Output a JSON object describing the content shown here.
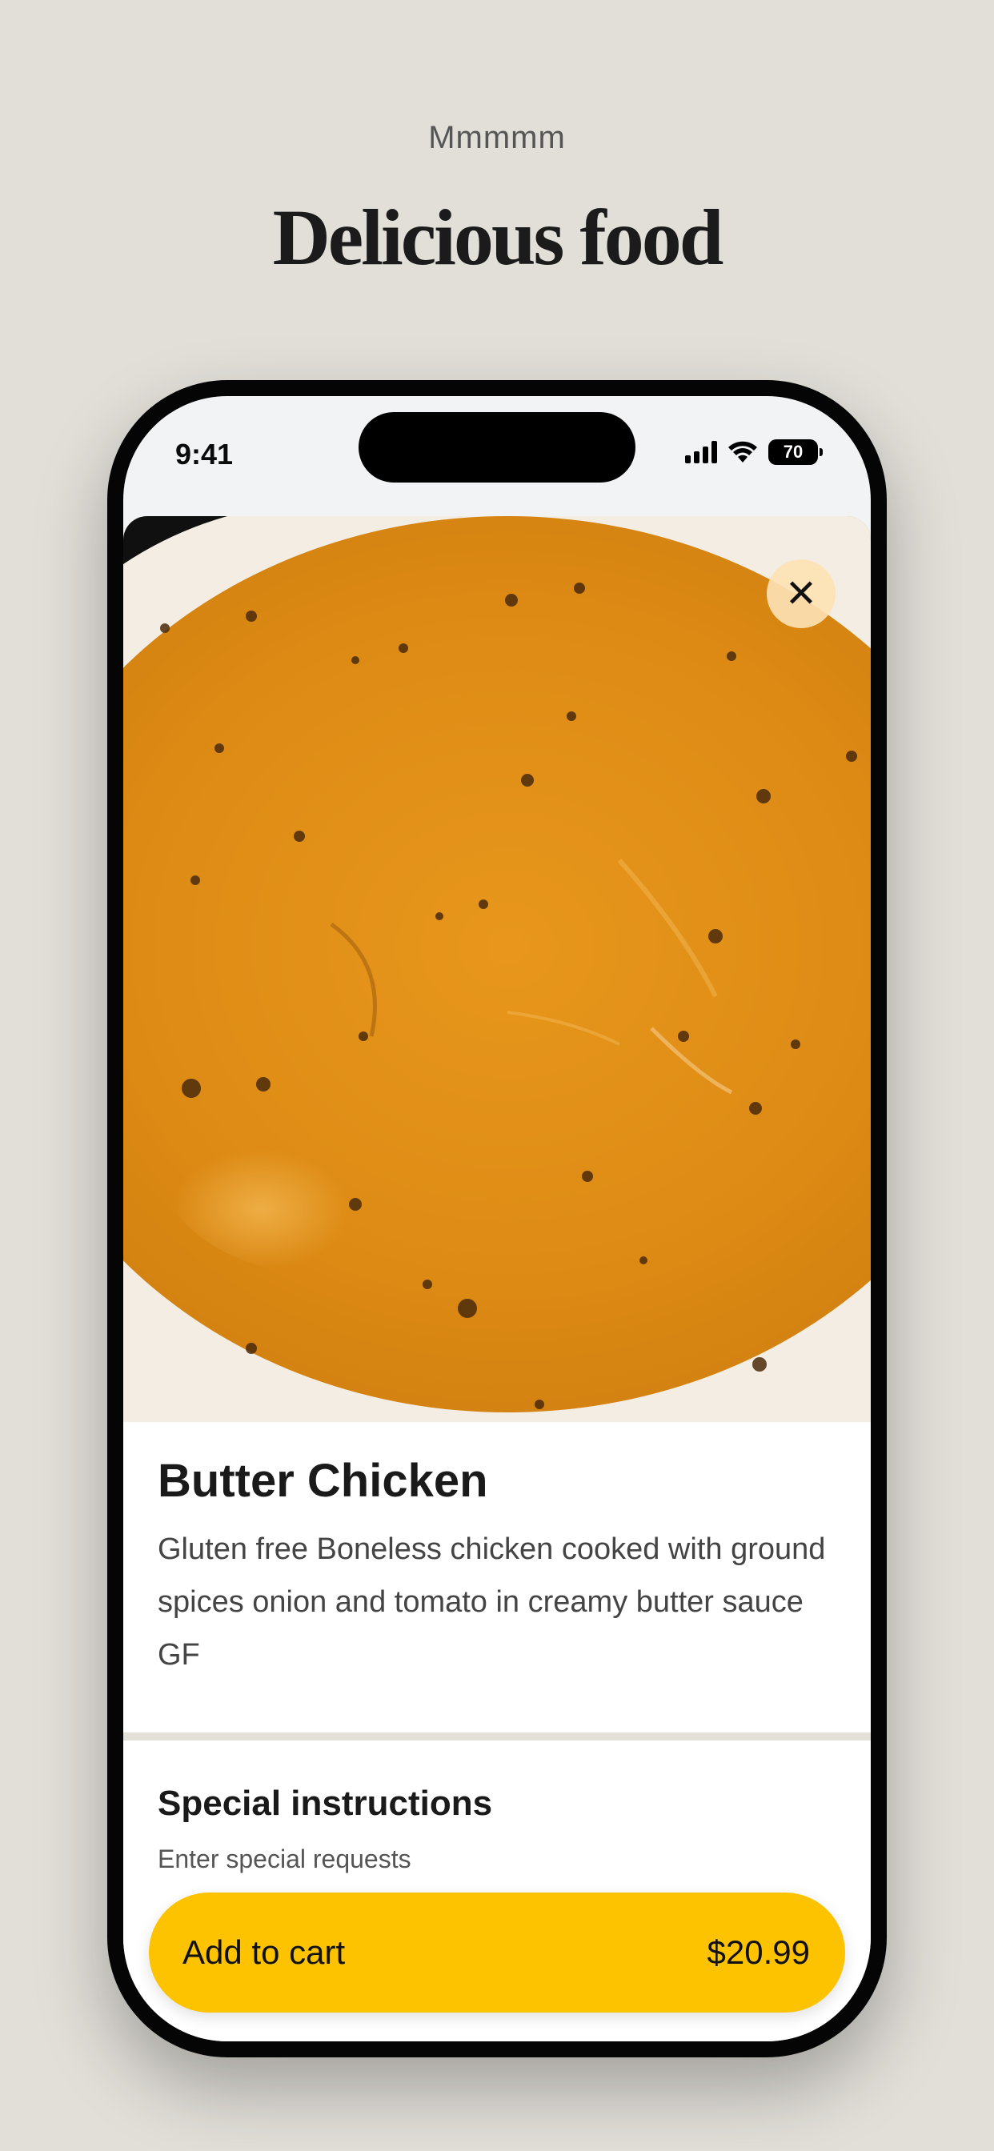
{
  "header": {
    "eyebrow": "Mmmmm",
    "title": "Delicious food"
  },
  "status_bar": {
    "time": "9:41",
    "battery": "70",
    "icons": [
      "cellular-signal-icon",
      "wifi-icon",
      "battery-icon"
    ]
  },
  "item": {
    "name": "Butter Chicken",
    "description": "Gluten free Boneless chicken cooked with ground spices onion and tomato in creamy butter sauce GF",
    "image": "butter-chicken-photo"
  },
  "special_instructions": {
    "title": "Special instructions",
    "placeholder": "Enter special requests"
  },
  "cart": {
    "label": "Add to cart",
    "price": "$20.99"
  },
  "colors": {
    "background": "#e2dfd9",
    "accent": "#fdc200",
    "sauce": "#d98a12"
  }
}
